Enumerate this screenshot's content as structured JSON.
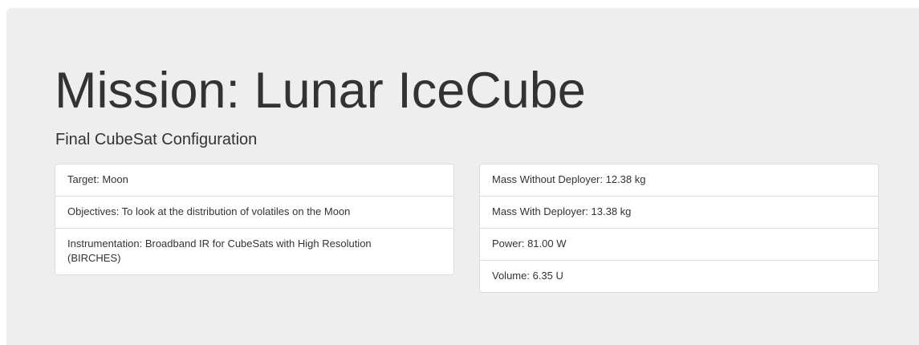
{
  "header": {
    "title": "Mission: Lunar IceCube",
    "subtitle": "Final CubeSat Configuration"
  },
  "mission_details": [
    "Target: Moon",
    "Objectives: To look at the distribution of volatiles on the Moon",
    "Instrumentation: Broadband IR for CubeSats with High Resolution (BIRCHES)"
  ],
  "specs": [
    "Mass Without Deployer: 12.38 kg",
    "Mass With Deployer: 13.38 kg",
    "Power: 81.00 W",
    "Volume: 6.35 U"
  ]
}
